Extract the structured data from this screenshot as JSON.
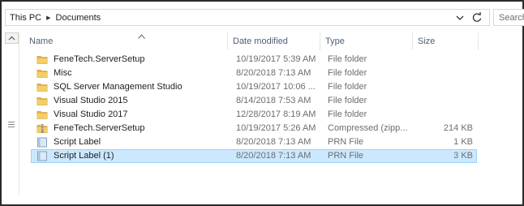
{
  "address": {
    "segments": [
      "This PC",
      "Documents"
    ],
    "search_placeholder": "Search"
  },
  "columns": [
    "Name",
    "Date modified",
    "Type",
    "Size"
  ],
  "files": [
    {
      "name": "FeneTech.ServerSetup",
      "date": "10/19/2017 5:39 AM",
      "type": "File folder",
      "size": "",
      "icon": "folder-icon"
    },
    {
      "name": "Misc",
      "date": "8/20/2018 7:13 AM",
      "type": "File folder",
      "size": "",
      "icon": "folder-icon"
    },
    {
      "name": "SQL Server Management Studio",
      "date": "10/19/2017 10:06 ...",
      "type": "File folder",
      "size": "",
      "icon": "folder-icon"
    },
    {
      "name": "Visual Studio 2015",
      "date": "8/14/2018 7:53 AM",
      "type": "File folder",
      "size": "",
      "icon": "folder-icon"
    },
    {
      "name": "Visual Studio 2017",
      "date": "12/28/2017 8:19 AM",
      "type": "File folder",
      "size": "",
      "icon": "folder-icon"
    },
    {
      "name": "FeneTech.ServerSetup",
      "date": "10/19/2017 5:26 AM",
      "type": "Compressed (zipp...",
      "size": "214 KB",
      "icon": "zip-folder-icon"
    },
    {
      "name": "Script Label",
      "date": "8/20/2018 7:13 AM",
      "type": "PRN File",
      "size": "1 KB",
      "icon": "prn-file-icon"
    },
    {
      "name": "Script Label (1)",
      "date": "8/20/2018 7:13 AM",
      "type": "PRN File",
      "size": "3 KB",
      "icon": "prn-file-icon",
      "selected": true
    }
  ],
  "colors": {
    "header_text": "#4c607a",
    "selection_bg": "#cce8ff",
    "selection_border": "#99d1ff",
    "folder_yellow": "#e8b846"
  }
}
